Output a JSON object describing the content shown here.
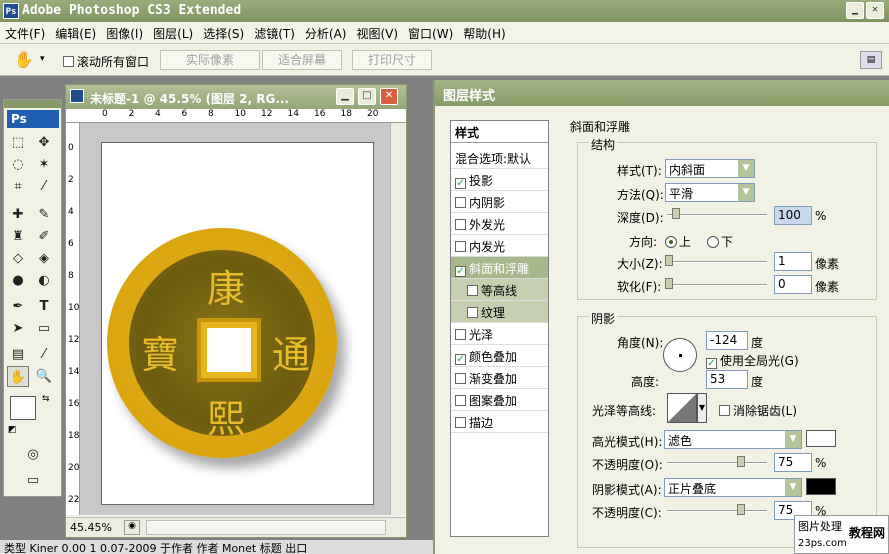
{
  "app": {
    "title": "Adobe Photoshop CS3 Extended",
    "ps_badge": "Ps"
  },
  "menu": [
    "文件(F)",
    "编辑(E)",
    "图像(I)",
    "图层(L)",
    "选择(S)",
    "滤镜(T)",
    "分析(A)",
    "视图(V)",
    "窗口(W)",
    "帮助(H)"
  ],
  "options": {
    "scroll_all": "滚动所有窗口",
    "actual_pixels": "实际像素",
    "fit_screen": "适合屏幕",
    "print_size": "打印尺寸"
  },
  "toolbox": {
    "logo": "Ps"
  },
  "document": {
    "title": "未标题-1 @ 45.5% (图层 2, RG...",
    "zoom": "45.45%",
    "status_text": "类型   Kiner   0.00    1    0.07-2009  于作者  作者  Monet  标题  出口",
    "ruler_h": [
      "0",
      "2",
      "4",
      "6",
      "8",
      "10",
      "12",
      "14",
      "16",
      "18",
      "20"
    ],
    "ruler_v": [
      "0",
      "2",
      "4",
      "6",
      "8",
      "10",
      "12",
      "14",
      "16",
      "18",
      "20",
      "22"
    ],
    "coin_chars": [
      "康",
      "熙",
      "通",
      "寶"
    ]
  },
  "panel": {
    "title": "图层样式",
    "styles_header": "样式",
    "blend_options": "混合选项:默认",
    "styles": [
      {
        "label": "投影",
        "checked": true
      },
      {
        "label": "内阴影",
        "checked": false
      },
      {
        "label": "外发光",
        "checked": false
      },
      {
        "label": "内发光",
        "checked": false
      },
      {
        "label": "斜面和浮雕",
        "checked": true
      },
      {
        "label": "等高线",
        "checked": false
      },
      {
        "label": "纹理",
        "checked": false
      },
      {
        "label": "光泽",
        "checked": false
      },
      {
        "label": "颜色叠加",
        "checked": true
      },
      {
        "label": "渐变叠加",
        "checked": false
      },
      {
        "label": "图案叠加",
        "checked": false
      },
      {
        "label": "描边",
        "checked": false
      }
    ],
    "bevel_title": "斜面和浮雕",
    "structure_title": "结构",
    "style_label": "样式(T):",
    "style_value": "内斜面",
    "technique_label": "方法(Q):",
    "technique_value": "平滑",
    "depth_label": "深度(D):",
    "depth_value": "100",
    "pct": "%",
    "direction_label": "方向:",
    "dir_up": "上",
    "dir_down": "下",
    "size_label": "大小(Z):",
    "size_value": "1",
    "px": "像素",
    "soften_label": "软化(F):",
    "soften_value": "0",
    "shading_title": "阴影",
    "angle_label": "角度(N):",
    "angle_value": "-124",
    "deg": "度",
    "global_light": "使用全局光(G)",
    "altitude_label": "高度:",
    "altitude_value": "53",
    "gloss_label": "光泽等高线:",
    "anti_alias": "消除锯齿(L)",
    "highlight_label": "高光模式(H):",
    "highlight_value": "滤色",
    "highlight_color": "#ffffff",
    "opacity1_label": "不透明度(O):",
    "opacity1_value": "75",
    "shadow_label": "阴影模式(A):",
    "shadow_value": "正片叠底",
    "shadow_color": "#000000",
    "opacity2_label": "不透明度(C):",
    "opacity2_value": "75"
  },
  "watermark": {
    "line1": "图片处理",
    "line2": "教程网",
    "line3": "23ps.com"
  }
}
